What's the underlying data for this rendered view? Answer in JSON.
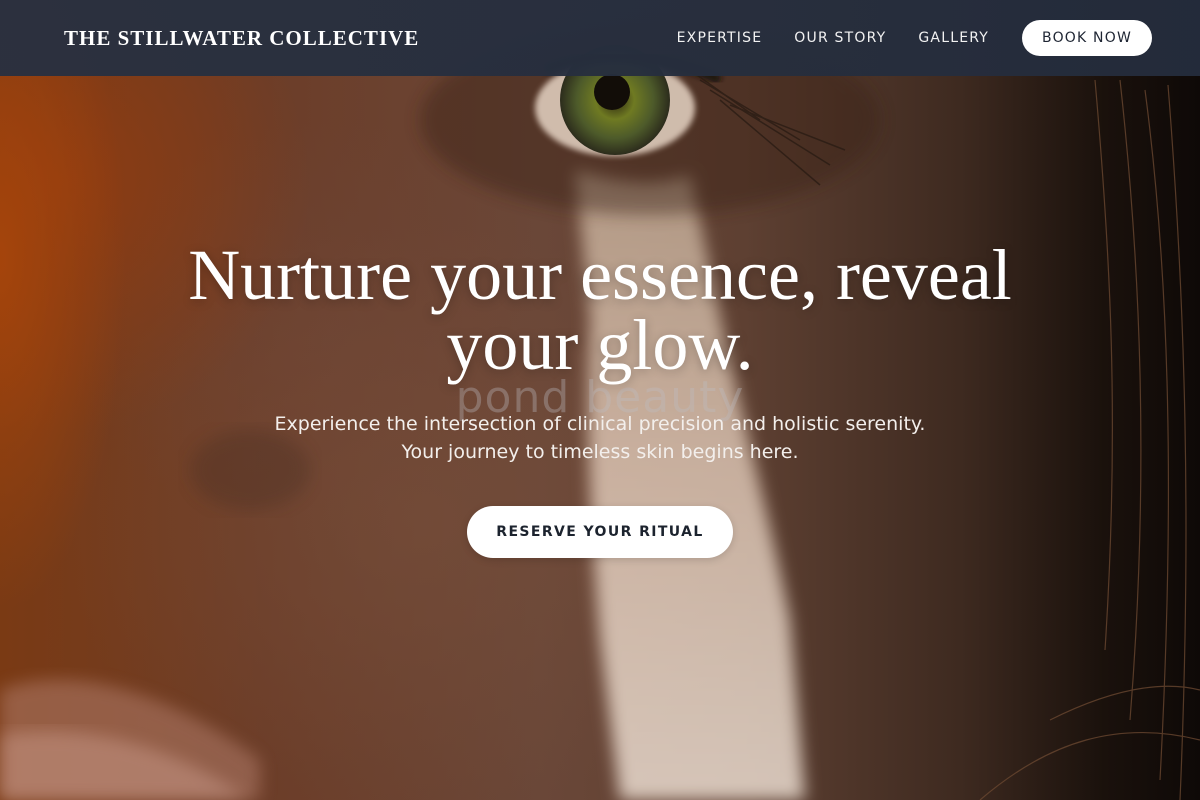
{
  "header": {
    "brand": "THE STILLWATER COLLECTIVE",
    "nav": [
      "EXPERTISE",
      "OUR STORY",
      "GALLERY"
    ],
    "book_label": "BOOK NOW"
  },
  "hero": {
    "headline": "Nurture your essence, reveal your glow.",
    "watermark": "pond beauty",
    "subtitle_line1": "Experience the intersection of clinical precision and holistic serenity.",
    "subtitle_line2": "Your journey to timeless skin begins here.",
    "cta_label": "RESERVE YOUR RITUAL"
  },
  "colors": {
    "nav_bg": "#283040",
    "button_bg": "#ffffff",
    "button_text": "#1c232e",
    "headline_text": "#ffffff"
  }
}
